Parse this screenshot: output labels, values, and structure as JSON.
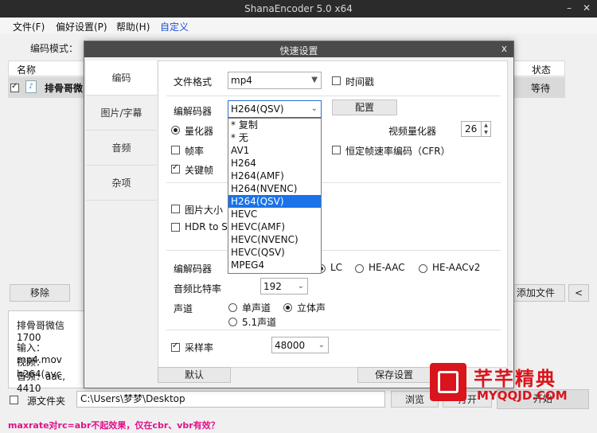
{
  "window": {
    "title": "ShanaEncoder 5.0 x64",
    "min": "–",
    "close": "✕"
  },
  "menu": {
    "items": [
      "文件(F)",
      "偏好设置(P)",
      "帮助(H)",
      "自定义"
    ]
  },
  "main": {
    "encode_mode_label": "编码模式：",
    "col_name": "名称",
    "col_status": "状态",
    "row_name": "排骨哥微",
    "row_status": "等待",
    "remove_btn": "移除",
    "add_file_btn": "添加文件",
    "arrow_btn": "<",
    "file_title": "排骨哥微信1700",
    "info_input": "输入：mp4.mov",
    "info_video": "视频：h264(avc",
    "info_audio": "音频：aac, 4410",
    "source_folder_label": "源文件夹",
    "output_path": "C:\\Users\\梦梦\\Desktop",
    "browse_btn": "浏览",
    "open_btn": "打开",
    "start_btn": "开始",
    "status_message": "maxrate对rc=abr不起效果，仅在cbr、vbr有效？"
  },
  "dialog": {
    "title": "快速设置",
    "close": "x",
    "tabs": [
      "编码",
      "图片/字幕",
      "音频",
      "杂项"
    ],
    "active_tab": "编码",
    "file_format_label": "文件格式",
    "file_format_value": "mp4",
    "timestamp_label": "时间戳",
    "codec_label": "编解码器",
    "codec_value": "H264(QSV)",
    "config_btn": "配置",
    "quantizer_label": "量化器",
    "video_quantizer_label": "视频量化器",
    "video_quantizer_value": "26",
    "framerate_label": "帧率",
    "cfr_label": "恒定帧速率编码（CFR）",
    "keyframe_label": "关键帧",
    "image_size_label": "图片大小",
    "hdr_label": "HDR to SD",
    "audio_codec_label": "编解码器",
    "lc_label": "LC",
    "he_aac_label": "HE-AAC",
    "he_aacv2_label": "HE-AACv2",
    "audio_bitrate_label": "音频比特率",
    "audio_bitrate_value": "192",
    "channel_label": "声道",
    "mono_label": "单声道",
    "stereo_label": "立体声",
    "surround_label": "5.1声道",
    "samplerate_label": "采样率",
    "samplerate_value": "48000",
    "default_btn": "默认",
    "save_btn": "保存设置",
    "codec_options": [
      "* 复制",
      "* 无",
      "AV1",
      "H264",
      "H264(AMF)",
      "H264(NVENC)",
      "H264(QSV)",
      "HEVC",
      "HEVC(AMF)",
      "HEVC(NVENC)",
      "HEVC(QSV)",
      "MPEG4"
    ],
    "codec_selected_index": 6
  },
  "watermark": {
    "text": "芊芊精典",
    "url": "MYQQJD.COM"
  },
  "colors": {
    "selection": "#1a73e8",
    "status": "#e0118a",
    "watermark_red": "#d9141c"
  }
}
